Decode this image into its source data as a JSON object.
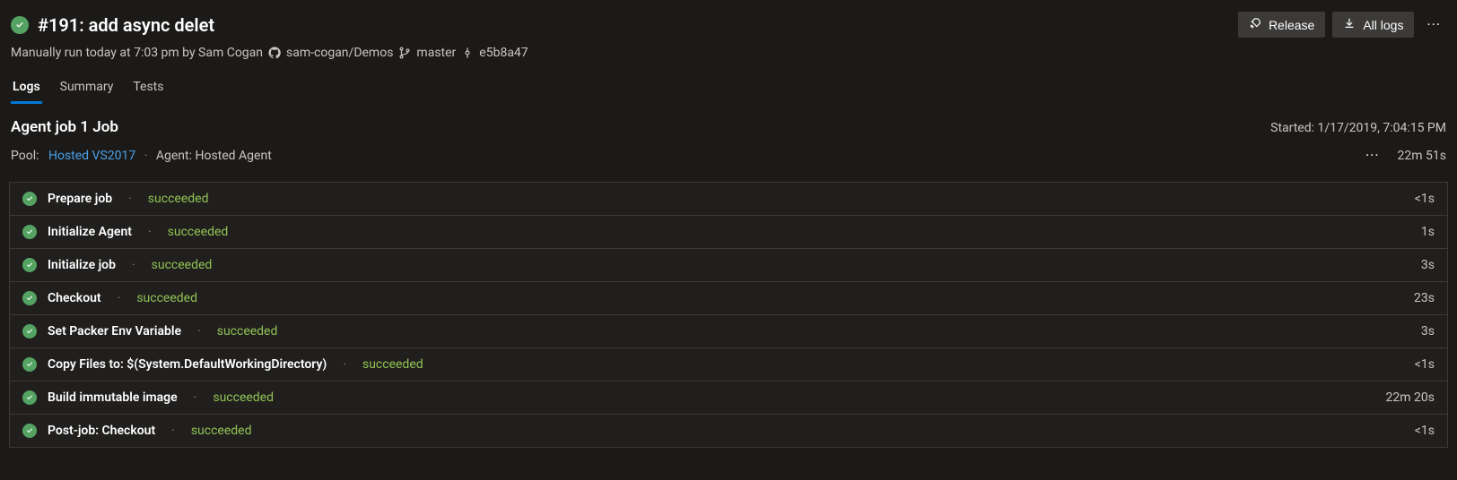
{
  "header": {
    "build_title": "#191: add async delet",
    "run_meta_prefix": "Manually run today at 7:03 pm by Sam Cogan",
    "repo": "sam-cogan/Demos",
    "branch": "master",
    "commit": "e5b8a47",
    "release_label": "Release",
    "all_logs_label": "All logs"
  },
  "tabs": {
    "items": [
      {
        "label": "Logs",
        "active": true
      },
      {
        "label": "Summary",
        "active": false
      },
      {
        "label": "Tests",
        "active": false
      }
    ]
  },
  "job": {
    "title": "Agent job 1 Job",
    "started_label": "Started: 1/17/2019, 7:04:15 PM",
    "pool_label": "Pool:",
    "pool_link": "Hosted VS2017",
    "agent_label": "Agent: Hosted Agent",
    "duration": "22m 51s"
  },
  "steps": [
    {
      "name": "Prepare job",
      "status": "succeeded",
      "duration": "<1s"
    },
    {
      "name": "Initialize Agent",
      "status": "succeeded",
      "duration": "1s"
    },
    {
      "name": "Initialize job",
      "status": "succeeded",
      "duration": "3s"
    },
    {
      "name": "Checkout",
      "status": "succeeded",
      "duration": "23s"
    },
    {
      "name": "Set Packer Env Variable",
      "status": "succeeded",
      "duration": "3s"
    },
    {
      "name": "Copy Files to: $(System.DefaultWorkingDirectory)",
      "status": "succeeded",
      "duration": "<1s"
    },
    {
      "name": "Build immutable image",
      "status": "succeeded",
      "duration": "22m 20s"
    },
    {
      "name": "Post-job: Checkout",
      "status": "succeeded",
      "duration": "<1s"
    }
  ]
}
